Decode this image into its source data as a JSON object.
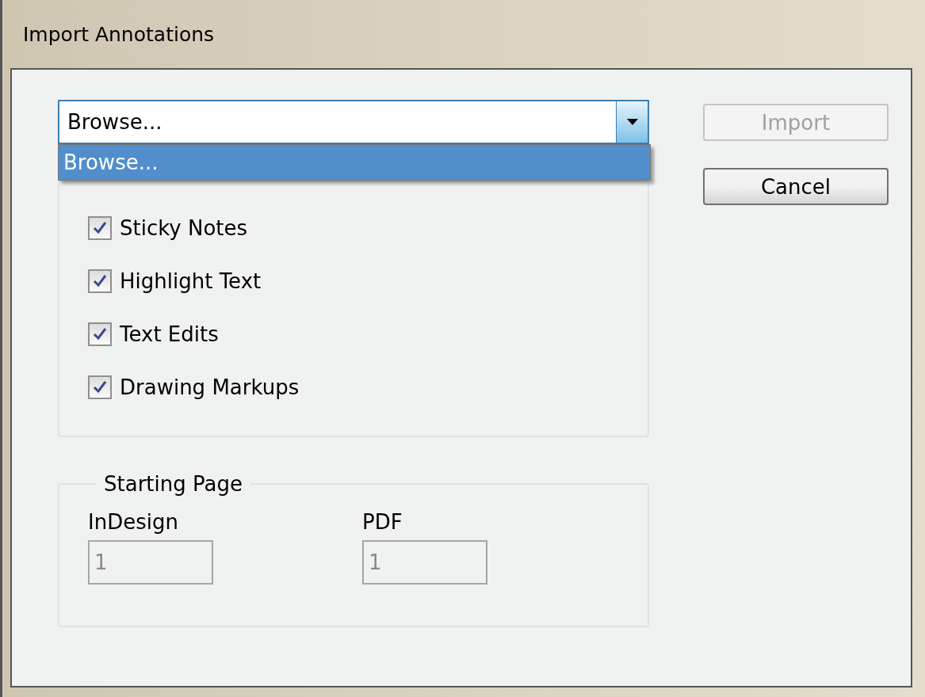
{
  "window": {
    "title": "Import Annotations"
  },
  "source": {
    "value": "Browse...",
    "expanded": true,
    "options": [
      {
        "label": "Browse...",
        "selected": true
      }
    ]
  },
  "buttons": [
    {
      "label": "Import",
      "disabled": true
    },
    {
      "label": "Cancel",
      "disabled": false
    }
  ],
  "annotations": {
    "items": [
      {
        "label": "Sticky Notes",
        "checked": true
      },
      {
        "label": "Highlight Text",
        "checked": true
      },
      {
        "label": "Text Edits",
        "checked": true
      },
      {
        "label": "Drawing Markups",
        "checked": true
      }
    ]
  },
  "starting_page": {
    "title": "Starting Page",
    "fields": [
      {
        "label": "InDesign",
        "value": "1",
        "disabled": true
      },
      {
        "label": "PDF",
        "value": "1",
        "disabled": true
      }
    ]
  }
}
